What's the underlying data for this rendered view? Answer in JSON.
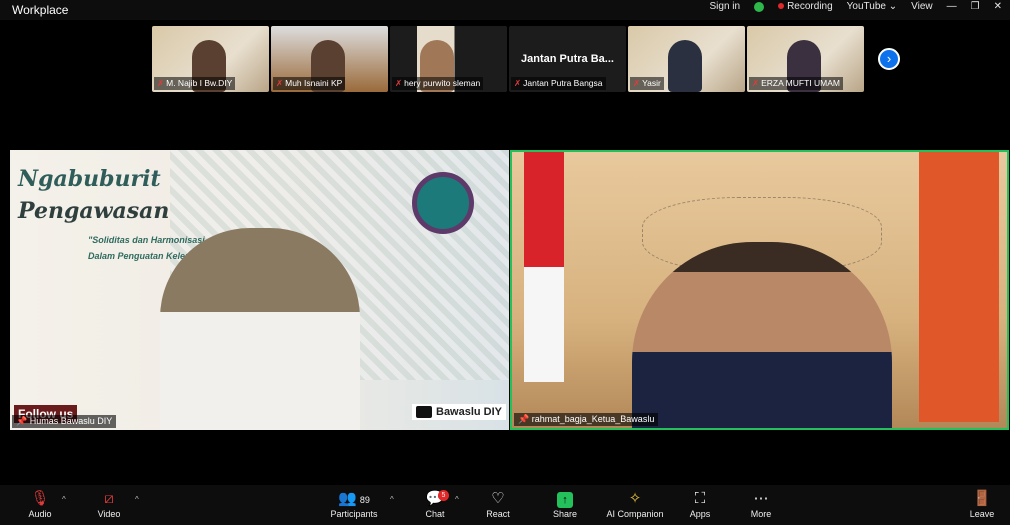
{
  "titlebar": {
    "title": "Workplace",
    "sign_in": "Sign in",
    "recording": "Recording",
    "youtube": "YouTube ⌄",
    "view": "View"
  },
  "gallery": [
    {
      "name": "M. Najib I Bw.DIY",
      "video": true
    },
    {
      "name": "Muh Isnaini KP",
      "video": true
    },
    {
      "name": "hery purwito sleman",
      "video": true
    },
    {
      "name": "Jantan Putra Bangsa",
      "display": "Jantan Putra Ba...",
      "video": false
    },
    {
      "name": "Yasir",
      "video": true
    },
    {
      "name": "ERZA MUFTI UMAM",
      "video": true
    }
  ],
  "main": {
    "left": {
      "name": "Humas Bawaslu DIY",
      "poster_title_1": "Ngabuburit",
      "poster_title_2": "Pengawasan",
      "poster_sub_1": "\"Soliditas dan Harmonisasi",
      "poster_sub_2": "Dalam Penguatan Kelembagaa",
      "follow": "Follow us",
      "social": "Bawaslu DIY"
    },
    "right": {
      "name": "rahmat_bagja_Ketua_Bawaslu",
      "active_speaker_color": "#23c05b"
    }
  },
  "toolbar": {
    "audio": "Audio",
    "video": "Video",
    "participants": "Participants",
    "participants_count": "89",
    "chat": "Chat",
    "chat_badge": "5",
    "react": "React",
    "share": "Share",
    "ai": "AI Companion",
    "apps": "Apps",
    "more": "More",
    "leave": "Leave"
  }
}
